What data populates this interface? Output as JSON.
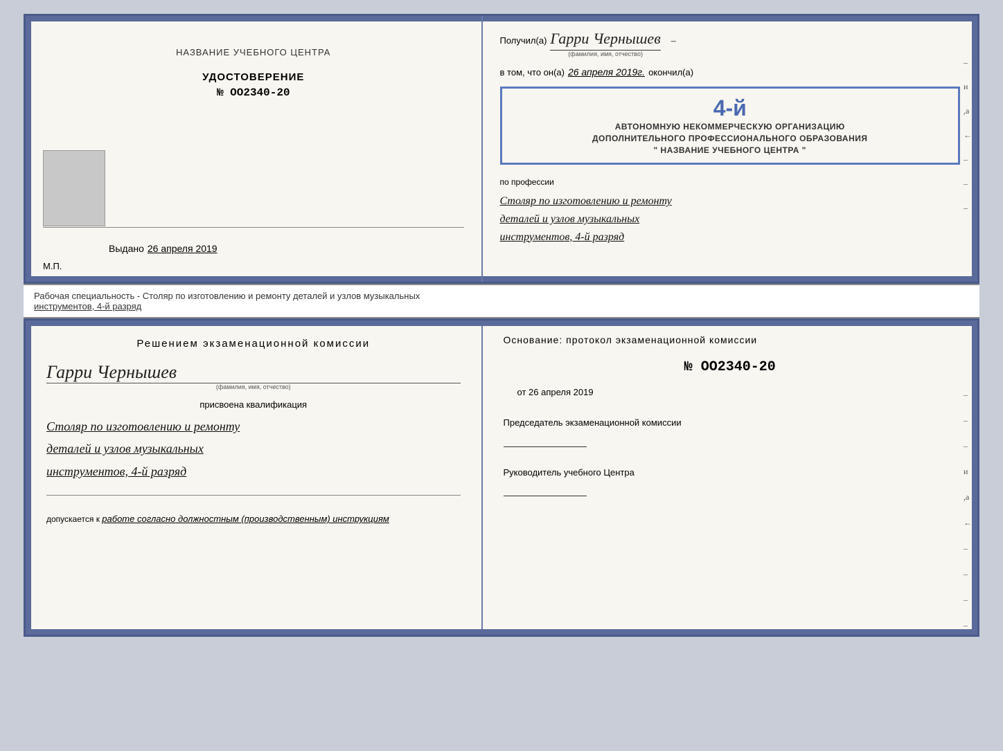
{
  "top_left": {
    "title": "НАЗВАНИЕ УЧЕБНОГО ЦЕНТРА",
    "udostoverenie": "УДОСТОВЕРЕНИЕ",
    "number": "№ OO2340-20",
    "vydano_label": "Выдано",
    "vydano_date": "26 апреля 2019",
    "mp": "М.П."
  },
  "top_right": {
    "poluchil_label": "Получил(а)",
    "name": "Гарри Чернышев",
    "fio_hint": "(фамилия, имя, отчество)",
    "vtom_label": "в том, что он(а)",
    "date": "26 апреля 2019г.",
    "okonchil_label": "окончил(а)",
    "stamp_number": "4-й",
    "stamp_line1": "АВТОНОМНУЮ НЕКОММЕРЧЕСКУЮ ОРГАНИЗАЦИЮ",
    "stamp_line2": "ДОПОЛНИТЕЛЬНОГО ПРОФЕССИОНАЛЬНОГО ОБРАЗОВАНИЯ",
    "stamp_line3": "\" НАЗВАНИЕ УЧЕБНОГО ЦЕНТРА \"",
    "po_professii": "по профессии",
    "profession_line1": "Столяр по изготовлению и ремонту",
    "profession_line2": "деталей и узлов музыкальных",
    "profession_line3": "инструментов, 4-й разряд"
  },
  "separator": {
    "label": "Рабочая специальность - Столяр по изготовлению и ремонту деталей и узлов музыкальных",
    "label2": "инструментов, 4-й разряд"
  },
  "bottom_left": {
    "resheniem": "Решением экзаменационной комиссии",
    "name": "Гарри Чернышев",
    "fio_hint": "(фамилия, имя, отчество)",
    "prisvoena": "присвоена квалификация",
    "profession_line1": "Столяр по изготовлению и ремонту",
    "profession_line2": "деталей и узлов музыкальных",
    "profession_line3": "инструментов, 4-й разряд",
    "dopuskaetsya": "допускается к",
    "dopusk_text": "работе согласно должностным (производственным) инструкциям"
  },
  "bottom_right": {
    "osnovanie": "Основание: протокол экзаменационной комиссии",
    "number": "№ OO2340-20",
    "ot_label": "от",
    "ot_date": "26 апреля 2019",
    "predsedatel": "Председатель экзаменационной комиссии",
    "rukovoditel": "Руководитель учебного Центра"
  },
  "right_dashes": [
    "-",
    "-",
    "-",
    "и",
    ",а",
    "←",
    "-",
    "-",
    "-",
    "-"
  ],
  "right_dashes_bottom": [
    "-",
    "-",
    "-",
    "и",
    ",а",
    "←",
    "-",
    "-",
    "-",
    "-"
  ]
}
